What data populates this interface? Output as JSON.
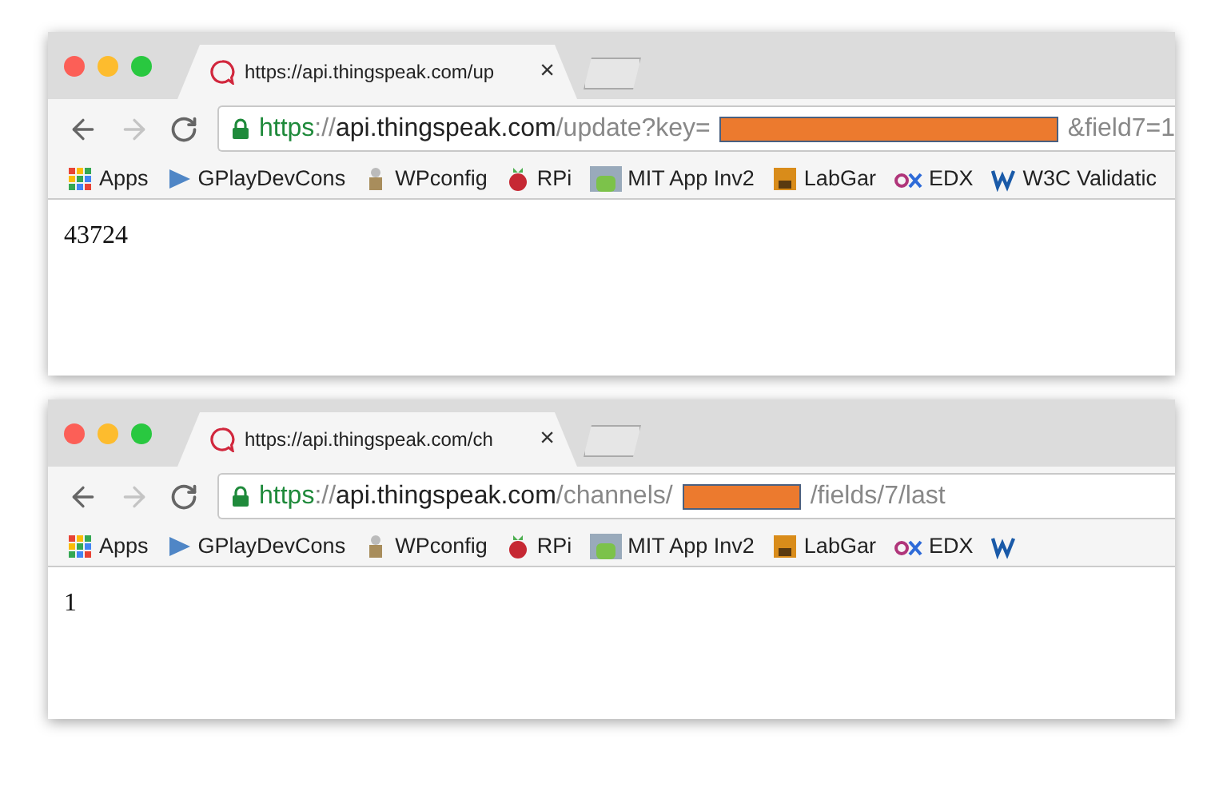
{
  "windows": [
    {
      "tab": {
        "title": "https://api.thingspeak.com/up",
        "close": "×",
        "selected": true
      },
      "url": {
        "prefix": [
          {
            "kind": "scheme",
            "text": "https"
          },
          {
            "kind": "plain",
            "text": "://"
          },
          {
            "kind": "host",
            "text": "api.thingspeak.com"
          },
          {
            "kind": "path",
            "text": "/update?key="
          }
        ],
        "redacted": true,
        "suffix": [
          {
            "kind": "path",
            "text": "&field7=1"
          }
        ]
      },
      "bookmarks": [
        {
          "kind": "link",
          "label": "Apps"
        },
        {
          "kind": "link",
          "label": "GPlayDevCons"
        },
        {
          "kind": "link",
          "label": "WPconfig"
        },
        {
          "kind": "link",
          "label": "RPi"
        },
        {
          "kind": "link",
          "label": "MIT App Inv2"
        },
        {
          "kind": "link",
          "label": "LabGar"
        },
        {
          "kind": "link",
          "label": "EDX"
        },
        {
          "kind": "link",
          "label": "W3C Validatic"
        }
      ],
      "content": "43724"
    },
    {
      "tab": {
        "title": "https://api.thingspeak.com/ch",
        "close": "×",
        "selected": true
      },
      "url": {
        "prefix": [
          {
            "kind": "scheme",
            "text": "https"
          },
          {
            "kind": "plain",
            "text": "://"
          },
          {
            "kind": "host",
            "text": "api.thingspeak.com"
          },
          {
            "kind": "path",
            "text": "/channels/"
          }
        ],
        "redacted": true,
        "suffix": [
          {
            "kind": "path",
            "text": "/fields/7/last"
          }
        ]
      },
      "bookmarks": [
        {
          "kind": "link",
          "label": "Apps"
        },
        {
          "kind": "link",
          "label": "GPlayDevCons"
        },
        {
          "kind": "link",
          "label": "WPconfig"
        },
        {
          "kind": "link",
          "label": "RPi"
        },
        {
          "kind": "link",
          "label": "MIT App Inv2"
        },
        {
          "kind": "link",
          "label": "LabGar"
        },
        {
          "kind": "link",
          "label": "EDX"
        },
        {
          "kind": "icon"
        }
      ],
      "content": "1"
    }
  ]
}
